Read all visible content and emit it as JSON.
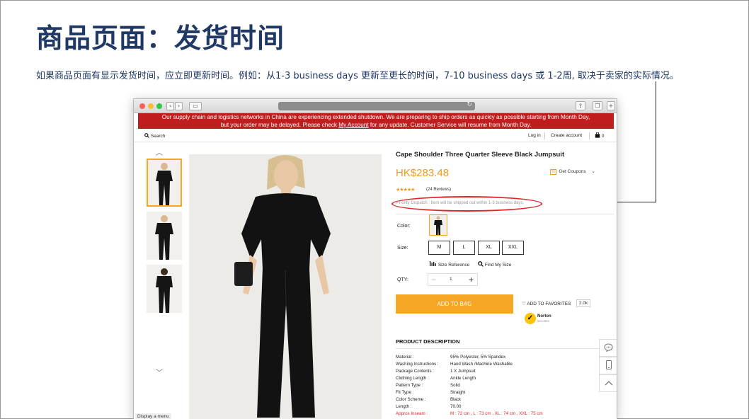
{
  "slide": {
    "title": "商品页面：发货时间",
    "description": "如果商品页面有显示发货时间，应立即更新时间。例如：从1-3 business days 更新至更长的时间，7-10 business days 或 1-2周, 取决于卖家的实际情况。"
  },
  "browser": {
    "banner": {
      "line1": "Our supply chain and logistics networks in China are experiencing extended shutdown. We are preparing to ship orders as quickly as possible starting from Month Day,",
      "line2_prefix": "but your order may be delayed. Please check ",
      "line2_link": "My Account",
      "line2_suffix": " for any update. Customer Service will resume from Month Day."
    },
    "topnav": {
      "search": "Search",
      "login": "Log in",
      "create_account": "Create account",
      "cart_count": "0"
    },
    "product": {
      "title": "Cape Shoulder Three Quarter Sleeve Black Jumpsuit",
      "price": "HK$283.48",
      "coupon_icon": "%",
      "coupon_label": "Get Coupons",
      "stars": "★★★★★",
      "rating": 4.5,
      "reviews": "(24 Reviews)",
      "dispatch": "Priority Dispatch : Item will be shipped out within 1-3 business days.",
      "color_label": "Color:",
      "size_label": "Size:",
      "sizes": [
        "M",
        "L",
        "XL",
        "XXL"
      ],
      "size_reference": "Size Reference",
      "find_my_size": "Find My Size",
      "qty_label": "QTY:",
      "qty_minus": "−",
      "qty_value": "1",
      "qty_plus": "+",
      "add_to_bag": "ADD TO BAG",
      "add_to_favorites": "ADD TO FAVORITES",
      "favorites_count": "2.0k",
      "norton_check": "✓",
      "norton": "Norton",
      "norton_sub": "SECURED"
    },
    "description": {
      "title": "PRODUCT DESCRIPTION",
      "specs": [
        {
          "k": "Material :",
          "v": "95% Polyester, 5% Spandex"
        },
        {
          "k": "Washing Instructions :",
          "v": "Hand Wash /Machine Washable"
        },
        {
          "k": "Package Contents :",
          "v": "1 X Jumpsuit"
        },
        {
          "k": "Clothing Length :",
          "v": "Ankle Length"
        },
        {
          "k": "Pattern Type :",
          "v": "Solid"
        },
        {
          "k": "Fit Type :",
          "v": "Straight"
        },
        {
          "k": "Color Scheme :",
          "v": "Black"
        },
        {
          "k": "Length :",
          "v": "70.00"
        },
        {
          "k": "Approx Inseam :",
          "v": "M : 72 cm , L : 73 cm , XL : 74 cm , XXL : 75 cm"
        }
      ]
    },
    "display_menu": "Display a menu"
  }
}
